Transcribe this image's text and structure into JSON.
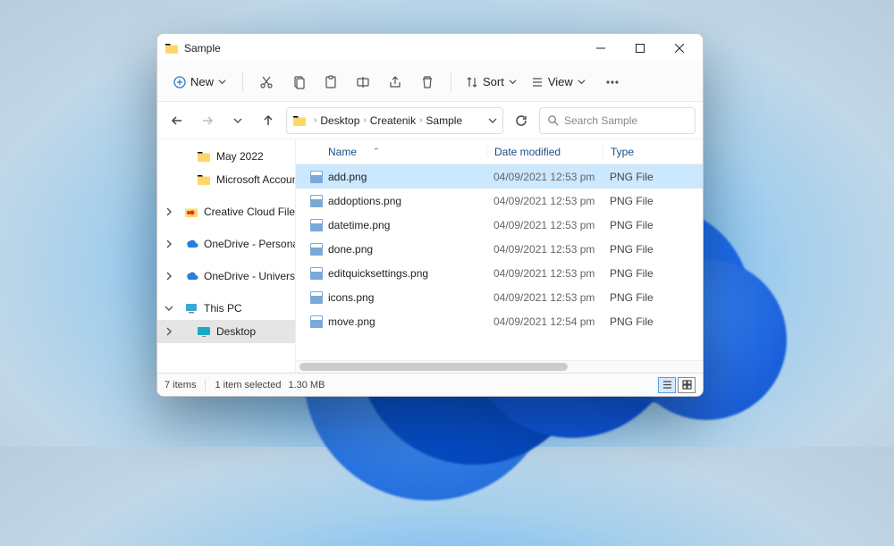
{
  "window": {
    "title": "Sample"
  },
  "toolbar": {
    "new_label": "New",
    "sort_label": "Sort",
    "view_label": "View"
  },
  "breadcrumb": {
    "p0": "Desktop",
    "p1": "Createnik",
    "p2": "Sample"
  },
  "search": {
    "placeholder": "Search Sample"
  },
  "sidebar": {
    "items": [
      {
        "label": "May 2022"
      },
      {
        "label": "Microsoft Account"
      },
      {
        "label": "Creative Cloud Files"
      },
      {
        "label": "OneDrive - Personal"
      },
      {
        "label": "OneDrive - University of t"
      },
      {
        "label": "This PC"
      },
      {
        "label": "Desktop"
      }
    ]
  },
  "columns": {
    "name": "Name",
    "date": "Date modified",
    "type": "Type"
  },
  "files": [
    {
      "name": "add.png",
      "date": "04/09/2021 12:53 pm",
      "type": "PNG File",
      "selected": true
    },
    {
      "name": "addoptions.png",
      "date": "04/09/2021 12:53 pm",
      "type": "PNG File",
      "selected": false
    },
    {
      "name": "datetime.png",
      "date": "04/09/2021 12:53 pm",
      "type": "PNG File",
      "selected": false
    },
    {
      "name": "done.png",
      "date": "04/09/2021 12:53 pm",
      "type": "PNG File",
      "selected": false
    },
    {
      "name": "editquicksettings.png",
      "date": "04/09/2021 12:53 pm",
      "type": "PNG File",
      "selected": false
    },
    {
      "name": "icons.png",
      "date": "04/09/2021 12:53 pm",
      "type": "PNG File",
      "selected": false
    },
    {
      "name": "move.png",
      "date": "04/09/2021 12:54 pm",
      "type": "PNG File",
      "selected": false
    }
  ],
  "status": {
    "count": "7 items",
    "selection": "1 item selected",
    "size": "1.30 MB"
  }
}
